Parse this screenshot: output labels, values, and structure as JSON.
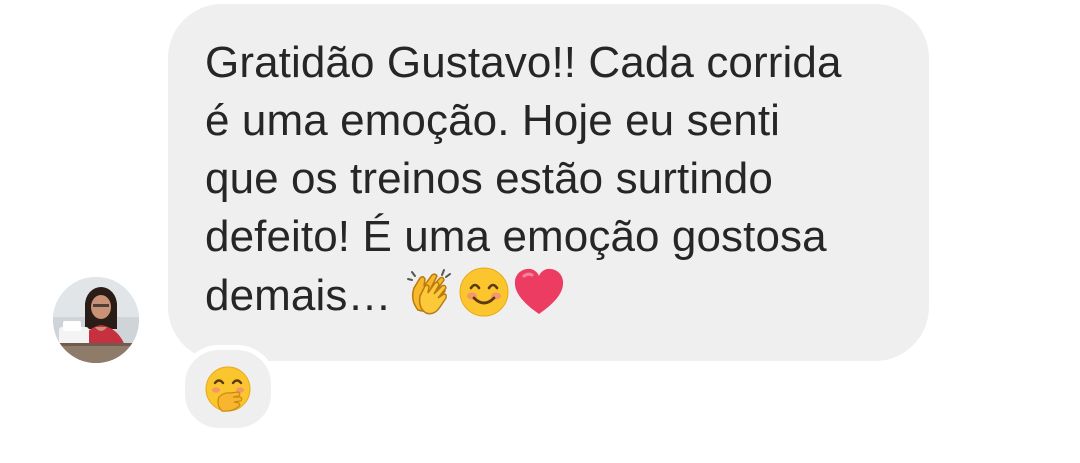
{
  "message": {
    "lines": [
      "Gratidão Gustavo!! Cada corrida",
      "é uma emoção. Hoje eu senti",
      "que os treinos estão surtindo",
      "defeito! É uma emoção gostosa",
      "demais…"
    ],
    "emojis": [
      "clapping-hands",
      "smiling-face-with-smiling-eyes",
      "red-heart"
    ]
  },
  "reaction": {
    "emoji": "face-with-hand-over-mouth"
  },
  "colors": {
    "bubble": "#efefef",
    "text": "#262626",
    "background": "#ffffff",
    "heart": "#e8345a",
    "emoji_yellow": "#fbc52d"
  }
}
